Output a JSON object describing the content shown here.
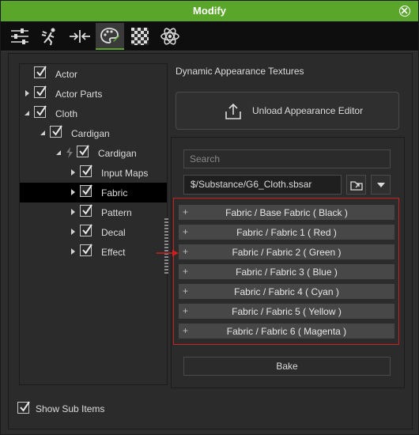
{
  "window": {
    "title": "Modify"
  },
  "toolbar": {
    "buttons": [
      {
        "icon": "sliders-icon"
      },
      {
        "icon": "motion-figure-icon"
      },
      {
        "icon": "transform-arrows-icon"
      },
      {
        "icon": "material-palette-icon",
        "active": true
      },
      {
        "icon": "checker-texture-icon"
      },
      {
        "icon": "atom-physics-icon"
      }
    ]
  },
  "tree": {
    "items": [
      {
        "label": "Actor",
        "level": 0,
        "expander": "none",
        "checked": true
      },
      {
        "label": "Actor Parts",
        "level": 0,
        "expander": "collapsed",
        "checked": true
      },
      {
        "label": "Cloth",
        "level": 0,
        "expander": "expanded",
        "checked": true
      },
      {
        "label": "Cardigan",
        "level": 1,
        "expander": "expanded",
        "checked": true
      },
      {
        "label": "Cardigan",
        "level": 2,
        "expander": "expanded",
        "checked": true,
        "linked": true
      },
      {
        "label": "Input Maps",
        "level": 3,
        "expander": "collapsed",
        "checked": true
      },
      {
        "label": "Fabric",
        "level": 3,
        "expander": "collapsed",
        "checked": true,
        "selected": true
      },
      {
        "label": "Pattern",
        "level": 3,
        "expander": "collapsed",
        "checked": true
      },
      {
        "label": "Decal",
        "level": 3,
        "expander": "collapsed",
        "checked": true
      },
      {
        "label": "Effect",
        "level": 3,
        "expander": "collapsed",
        "checked": true
      }
    ]
  },
  "panel": {
    "title": "Dynamic Appearance Textures",
    "unload_label": "Unload Appearance Editor",
    "search_placeholder": "Search",
    "path_value": "$/Substance/G6_Cloth.sbsar",
    "bake_label": "Bake"
  },
  "textures": [
    {
      "label": "Fabric / Base Fabric ( Black )"
    },
    {
      "label": "Fabric / Fabric 1 ( Red )"
    },
    {
      "label": "Fabric / Fabric 2 ( Green )"
    },
    {
      "label": "Fabric / Fabric 3 ( Blue )"
    },
    {
      "label": "Fabric / Fabric 4 ( Cyan )"
    },
    {
      "label": "Fabric / Fabric 5 ( Yellow )"
    },
    {
      "label": "Fabric / Fabric 6 ( Magenta )"
    }
  ],
  "footer": {
    "show_sub_items_label": "Show Sub Items",
    "show_sub_items_checked": true
  },
  "colors": {
    "title_bar": "#5aa62a",
    "annotation": "#cc2020",
    "selection": "#000000"
  }
}
